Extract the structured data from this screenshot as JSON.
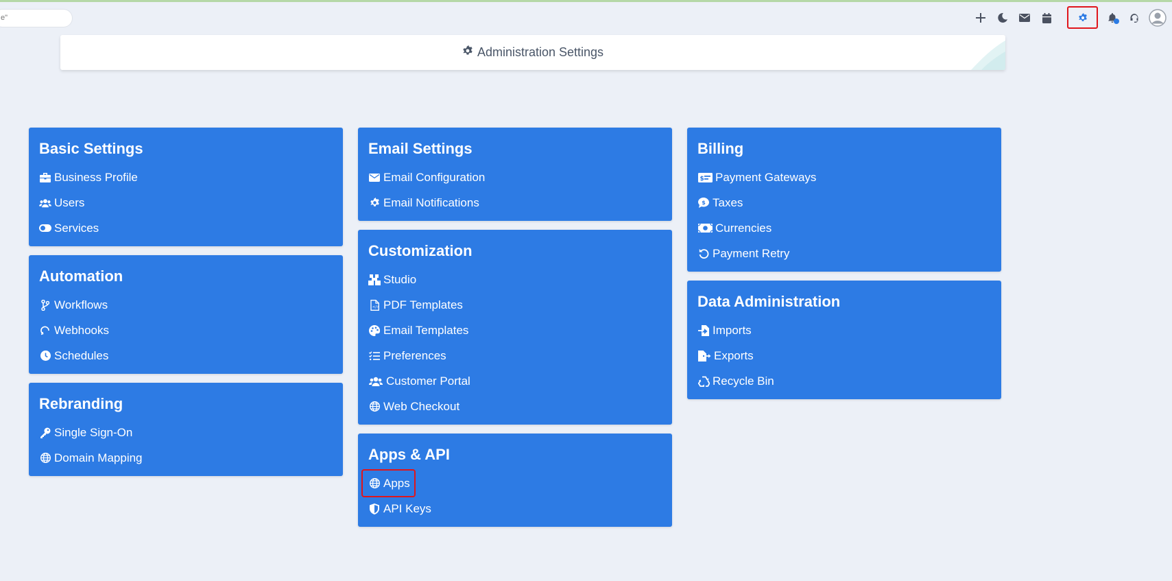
{
  "search": {
    "text": "e\""
  },
  "toolbar": {
    "icons": [
      "plus-icon",
      "moon-icon",
      "envelope-icon",
      "calendar-icon",
      "gear-icon",
      "bell-icon",
      "headset-icon",
      "avatar"
    ],
    "selected": "gear-icon",
    "selected_color": "#e0151b",
    "notification_color": "#2b7be4"
  },
  "header": {
    "title": "Administration Settings",
    "icon": "gear-icon"
  },
  "colors": {
    "card": "#2d7be4",
    "background": "#ecf0f7",
    "highlight": "#e0151b"
  },
  "sections": {
    "basic": {
      "title": "Basic Settings",
      "items": [
        {
          "label": "Business Profile",
          "icon": "briefcase-icon"
        },
        {
          "label": "Users",
          "icon": "users-icon"
        },
        {
          "label": "Services",
          "icon": "toggle-icon"
        }
      ]
    },
    "automation": {
      "title": "Automation",
      "items": [
        {
          "label": "Workflows",
          "icon": "branch-icon"
        },
        {
          "label": "Webhooks",
          "icon": "webhook-icon"
        },
        {
          "label": "Schedules",
          "icon": "clock-icon"
        }
      ]
    },
    "rebranding": {
      "title": "Rebranding",
      "items": [
        {
          "label": "Single Sign-On",
          "icon": "key-icon"
        },
        {
          "label": "Domain Mapping",
          "icon": "globe-icon"
        }
      ]
    },
    "email": {
      "title": "Email Settings",
      "items": [
        {
          "label": "Email Configuration",
          "icon": "envelope-icon"
        },
        {
          "label": "Email Notifications",
          "icon": "gear-icon"
        }
      ]
    },
    "customization": {
      "title": "Customization",
      "items": [
        {
          "label": "Studio",
          "icon": "blocks-icon"
        },
        {
          "label": "PDF Templates",
          "icon": "file-code-icon"
        },
        {
          "label": "Email Templates",
          "icon": "palette-icon"
        },
        {
          "label": "Preferences",
          "icon": "list-check-icon"
        },
        {
          "label": "Customer Portal",
          "icon": "users-icon"
        },
        {
          "label": "Web Checkout",
          "icon": "globe-icon"
        }
      ]
    },
    "apps": {
      "title": "Apps & API",
      "items": [
        {
          "label": "Apps",
          "icon": "globe-icon",
          "selected": true
        },
        {
          "label": "API Keys",
          "icon": "shield-icon"
        }
      ]
    },
    "billing": {
      "title": "Billing",
      "items": [
        {
          "label": "Payment Gateways",
          "icon": "money-check-icon"
        },
        {
          "label": "Taxes",
          "icon": "dollar-comment-icon"
        },
        {
          "label": "Currencies",
          "icon": "money-bill-icon"
        },
        {
          "label": "Payment Retry",
          "icon": "rotate-left-icon"
        }
      ]
    },
    "data_admin": {
      "title": "Data Administration",
      "items": [
        {
          "label": "Imports",
          "icon": "file-import-icon"
        },
        {
          "label": "Exports",
          "icon": "file-export-icon"
        },
        {
          "label": "Recycle Bin",
          "icon": "recycle-icon"
        }
      ]
    }
  }
}
